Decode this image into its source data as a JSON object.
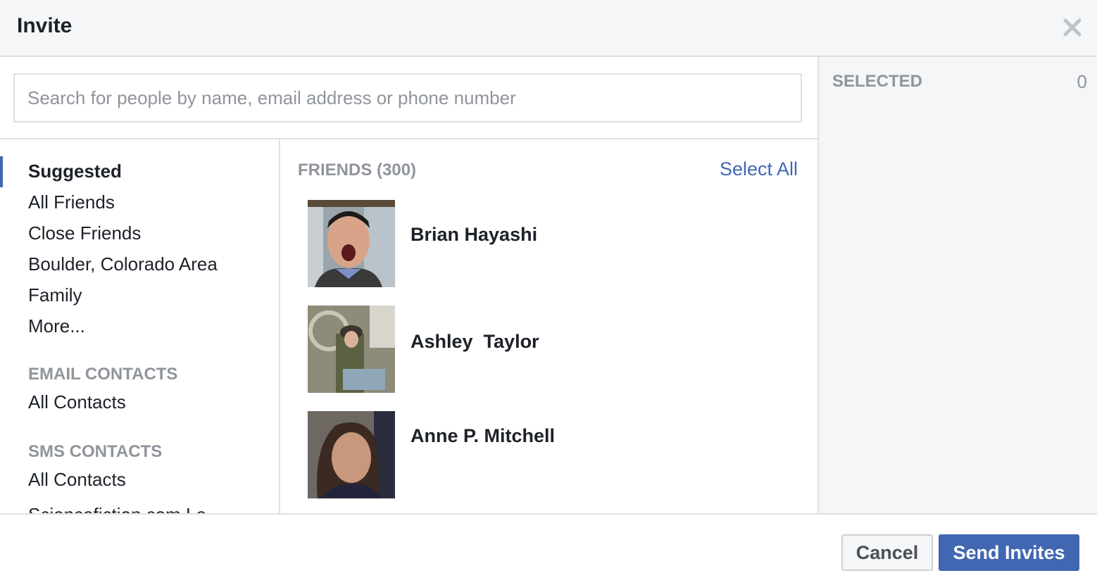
{
  "dialog": {
    "title": "Invite",
    "close_icon": "close-icon"
  },
  "search": {
    "value": "",
    "placeholder": "Search for people by name, email address or phone number"
  },
  "nav": {
    "items": [
      {
        "label": "Suggested",
        "active": true
      },
      {
        "label": "All Friends"
      },
      {
        "label": "Close Friends"
      },
      {
        "label": "Boulder, Colorado Area"
      },
      {
        "label": "Family"
      },
      {
        "label": "More..."
      }
    ],
    "email_section": {
      "title": "EMAIL CONTACTS",
      "items": [
        {
          "label": "All Contacts"
        }
      ]
    },
    "sms_section": {
      "title": "SMS CONTACTS",
      "items": [
        {
          "label": "All Contacts"
        }
      ]
    },
    "clipped_item": "Sciencefiction.com Le"
  },
  "friends": {
    "heading": "FRIENDS (300)",
    "select_all": "Select All",
    "list": [
      {
        "name": "Brian Hayashi"
      },
      {
        "name": "Ashley  Taylor"
      },
      {
        "name": "Anne P. Mitchell"
      }
    ]
  },
  "selected": {
    "label": "SELECTED",
    "count": "0"
  },
  "footer": {
    "cancel_label": "Cancel",
    "send_label": "Send Invites"
  },
  "colors": {
    "accent": "#4267b2",
    "muted_text": "#90949c",
    "header_bg": "#f5f6f7",
    "border": "#dddfe2"
  }
}
